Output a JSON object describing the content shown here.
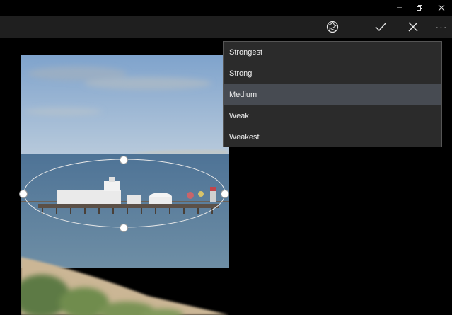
{
  "window": {
    "minimize_icon": "minimize-icon",
    "restore_icon": "restore-icon",
    "close_icon": "close-icon"
  },
  "toolbar": {
    "focus_icon": "aperture-icon",
    "apply_icon": "checkmark-icon",
    "cancel_icon": "close-icon",
    "more_label": "···"
  },
  "blur_menu": {
    "items": [
      "Strongest",
      "Strong",
      "Medium",
      "Weak",
      "Weakest"
    ],
    "selected": "Medium"
  },
  "colors": {
    "menu_bg": "#2b2b2b",
    "menu_selected": "#474b52",
    "toolbar_bg": "#1f1f1f"
  }
}
